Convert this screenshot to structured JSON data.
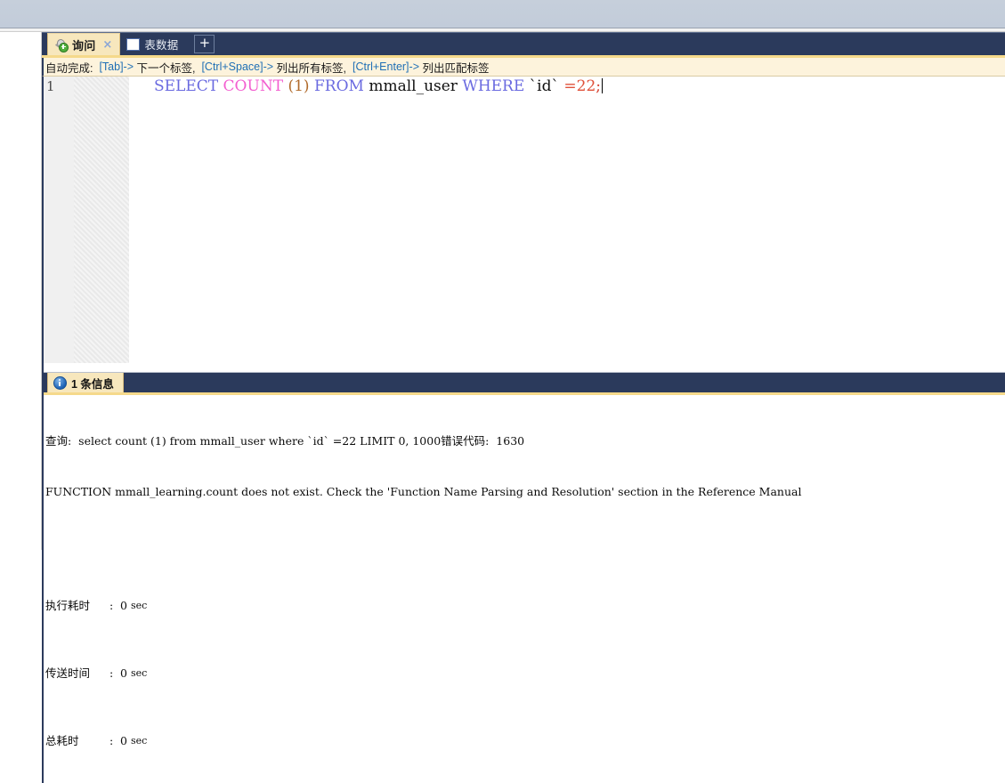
{
  "window": {
    "tabbar": {
      "tabs": [
        {
          "label": "询问",
          "icon": "query-icon",
          "active": true,
          "closable": true,
          "close_label": "×"
        },
        {
          "label": "表数据",
          "icon": "table-grid-icon",
          "active": false,
          "closable": false
        }
      ],
      "new_tab_label": "+"
    }
  },
  "hintbar": {
    "prefix": "自动完成:",
    "items": [
      {
        "key": "[Tab]",
        "arrow": "->",
        "desc": "下一个标签,"
      },
      {
        "key": "[Ctrl+Space]",
        "arrow": "->",
        "desc": "列出所有标签,"
      },
      {
        "key": "[Ctrl+Enter]",
        "arrow": "->",
        "desc": "列出匹配标签"
      }
    ]
  },
  "editor": {
    "line_number": "1",
    "sql": {
      "indent": "     ",
      "tokens": [
        {
          "text": "SELECT",
          "type": "keyword"
        },
        {
          "text": " ",
          "type": "plain"
        },
        {
          "text": "COUNT",
          "type": "function"
        },
        {
          "text": " ",
          "type": "plain"
        },
        {
          "text": "(",
          "type": "paren"
        },
        {
          "text": "1",
          "type": "paren"
        },
        {
          "text": ")",
          "type": "paren"
        },
        {
          "text": " ",
          "type": "plain"
        },
        {
          "text": "FROM",
          "type": "keyword"
        },
        {
          "text": " ",
          "type": "plain"
        },
        {
          "text": "mmall_user",
          "type": "identifier"
        },
        {
          "text": " ",
          "type": "plain"
        },
        {
          "text": "WHERE",
          "type": "keyword"
        },
        {
          "text": " ",
          "type": "plain"
        },
        {
          "text": "`id`",
          "type": "backtick-identifier"
        },
        {
          "text": " ",
          "type": "plain"
        },
        {
          "text": "=",
          "type": "number"
        },
        {
          "text": "22",
          "type": "number"
        },
        {
          "text": ";",
          "type": "punct"
        }
      ],
      "plain_text": "SELECT COUNT (1) FROM mmall_user WHERE `id` =22;"
    }
  },
  "messages": {
    "tab_label": "1 条信息",
    "tab_icon": "info-icon",
    "query_line": "查询:  select count (1) from mmall_user where `id` =22 LIMIT 0, 1000错误代码:  1630",
    "error_line": "FUNCTION mmall_learning.count does not exist. Check the 'Function Name Parsing and Resolution' section in the Reference Manual",
    "timings": [
      {
        "label": "执行耗时",
        "separator": ":",
        "value": "0",
        "unit": "sec"
      },
      {
        "label": "传送时间",
        "separator": ":",
        "value": "0",
        "unit": "sec"
      },
      {
        "label": "总耗时",
        "separator": ":",
        "value": "0",
        "unit": "sec"
      }
    ]
  },
  "colors": {
    "tabbar_navy": "#2b3a5c",
    "tab_active_cream": "#f7e7bd",
    "accent_gold": "#f5d98b",
    "hintbar_bg": "#fdf3dc",
    "hint_key_blue": "#1f6fb5",
    "sql_keyword": "#6a6ae0",
    "sql_function": "#f35fd0",
    "sql_paren": "#b06a2a",
    "sql_number": "#e0513a",
    "chrome_grey": "#c6cfdb"
  }
}
